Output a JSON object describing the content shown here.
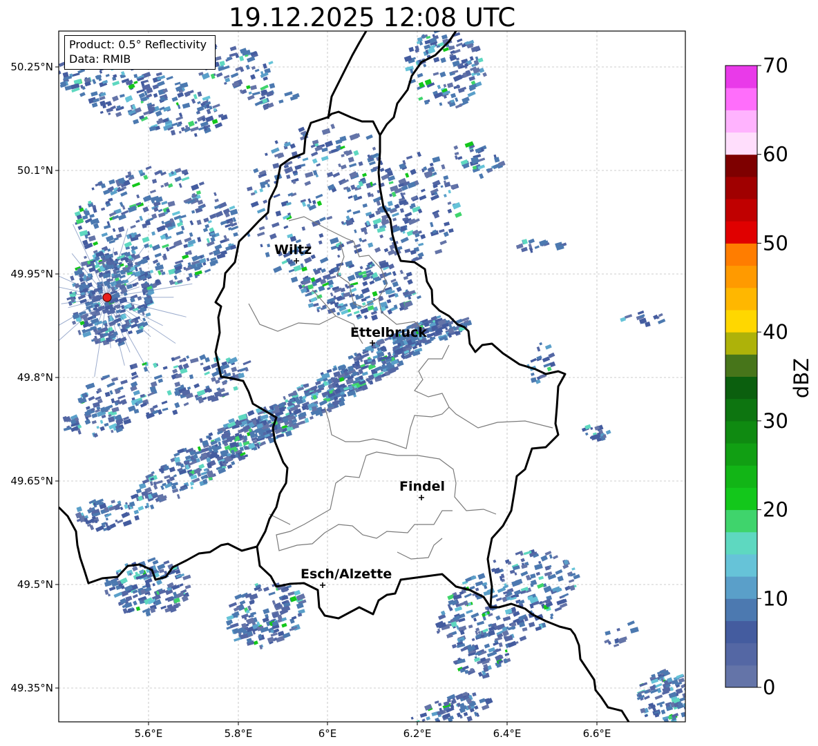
{
  "title": "19.12.2025 12:08 UTC",
  "info": {
    "product": "Product: 0.5° Reflectivity",
    "data": "Data: RMIB"
  },
  "map": {
    "x_ticks": [
      "5.6°E",
      "5.8°E",
      "6°E",
      "6.2°E",
      "6.4°E",
      "6.6°E"
    ],
    "y_ticks": [
      "50.25°N",
      "50.1°N",
      "49.95°N",
      "49.8°N",
      "49.65°N",
      "49.5°N",
      "49.35°N"
    ],
    "cities": [
      "Wiltz",
      "Ettelbruck",
      "Findel",
      "Esch/Alzette"
    ],
    "radar_site_color": "#e8201c"
  },
  "colorbar": {
    "label": "dBZ",
    "ticks": [
      "0",
      "10",
      "20",
      "30",
      "40",
      "50",
      "60",
      "70"
    ],
    "min": 0,
    "max": 70,
    "colors": [
      "#6474a8",
      "#5467a4",
      "#445c9f",
      "#4c79b0",
      "#5a9fc9",
      "#66c3d8",
      "#5ed8c0",
      "#3fd46c",
      "#13c71b",
      "#12b516",
      "#119f13",
      "#0f8a11",
      "#0d7510",
      "#0b5f0e",
      "#47751a",
      "#aeb209",
      "#ffd700",
      "#ffb700",
      "#ff9a00",
      "#ff7d00",
      "#e00000",
      "#c00000",
      "#a00000",
      "#7e0000",
      "#ffdefc",
      "#ffb3fe",
      "#ff6efb",
      "#e93ae9"
    ]
  }
}
